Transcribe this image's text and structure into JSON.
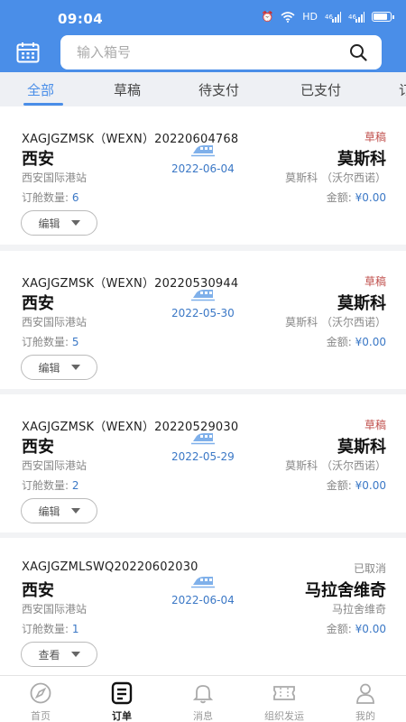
{
  "status_bar": {
    "time": "09:04",
    "hd": "HD",
    "signal1": "⁴⁶ıl",
    "signal2": "⁴⁶ıl"
  },
  "search": {
    "placeholder": "输入箱号"
  },
  "tabs": [
    {
      "label": "全部",
      "active": true
    },
    {
      "label": "草稿",
      "active": false
    },
    {
      "label": "待支付",
      "active": false
    },
    {
      "label": "已支付",
      "active": false
    },
    {
      "label": "订",
      "active": false
    }
  ],
  "orders": [
    {
      "order_no": "XAGJGZMSK（WEXN）20220604768",
      "status": "草稿",
      "from_city": "西安",
      "from_station": "西安国际港站",
      "to_city": "莫斯科",
      "to_station": "莫斯科 （沃尔西诺）",
      "date": "2022-06-04",
      "qty_label": "订舱数量: ",
      "qty": "6",
      "amount_label": "金额: ",
      "amount": "¥0.00",
      "action": "编辑"
    },
    {
      "order_no": "XAGJGZMSK（WEXN）20220530944",
      "status": "草稿",
      "from_city": "西安",
      "from_station": "西安国际港站",
      "to_city": "莫斯科",
      "to_station": "莫斯科 （沃尔西诺）",
      "date": "2022-05-30",
      "qty_label": "订舱数量: ",
      "qty": "5",
      "amount_label": "金额: ",
      "amount": "¥0.00",
      "action": "编辑"
    },
    {
      "order_no": "XAGJGZMSK（WEXN）20220529030",
      "status": "草稿",
      "from_city": "西安",
      "from_station": "西安国际港站",
      "to_city": "莫斯科",
      "to_station": "莫斯科 （沃尔西诺）",
      "date": "2022-05-29",
      "qty_label": "订舱数量: ",
      "qty": "2",
      "amount_label": "金额: ",
      "amount": "¥0.00",
      "action": "编辑"
    },
    {
      "order_no": "XAGJGZMLSWQ20220602030",
      "status": "已取消",
      "from_city": "西安",
      "from_station": "西安国际港站",
      "to_city": "马拉舍维奇",
      "to_station": "马拉舍维奇",
      "date": "2022-06-04",
      "qty_label": "订舱数量: ",
      "qty": "1",
      "amount_label": "金额: ",
      "amount": "¥0.00",
      "action": "查看"
    }
  ],
  "bottom_nav": [
    {
      "label": "首页",
      "icon": "compass-icon",
      "active": false
    },
    {
      "label": "订单",
      "icon": "order-list-icon",
      "active": true
    },
    {
      "label": "消息",
      "icon": "bell-icon",
      "active": false
    },
    {
      "label": "组织发运",
      "icon": "ticket-icon",
      "active": false
    },
    {
      "label": "我的",
      "icon": "user-icon",
      "active": false
    }
  ],
  "colors": {
    "primary": "#4a8ee8",
    "status_draft": "#c0504d",
    "status_cancelled": "#888888",
    "value_blue": "#3b78c6"
  }
}
